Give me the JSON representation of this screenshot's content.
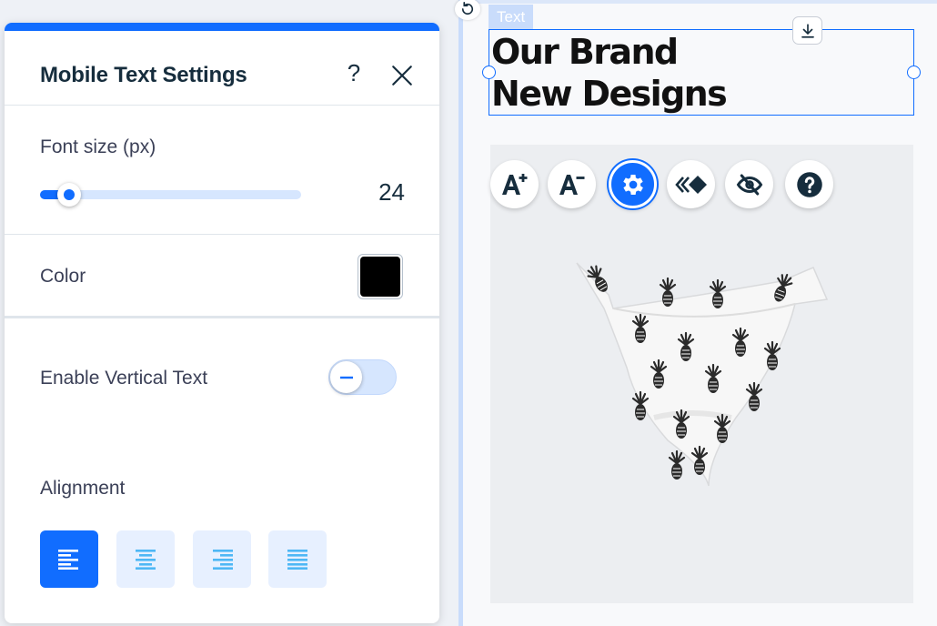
{
  "panel": {
    "title": "Mobile Text Settings",
    "help_label": "?",
    "font_size": {
      "label": "Font size (px)",
      "value": "24",
      "slider_fraction": 0.11
    },
    "color": {
      "label": "Color",
      "value": "#000000"
    },
    "vertical_text": {
      "label": "Enable Vertical Text",
      "enabled": false
    },
    "alignment": {
      "label": "Alignment",
      "options": [
        "align-left",
        "align-center",
        "align-right",
        "justify"
      ],
      "selected": "align-left"
    }
  },
  "canvas": {
    "element_tag": "Text",
    "heading_line1": "Our Brand",
    "heading_line2": "New Designs",
    "toolbar": [
      "increase-font-size",
      "decrease-font-size",
      "settings",
      "animation",
      "hide",
      "help"
    ]
  },
  "colors": {
    "accent": "#116dff",
    "accent_light": "#d6e6fe",
    "text_dark": "#162d3d"
  }
}
